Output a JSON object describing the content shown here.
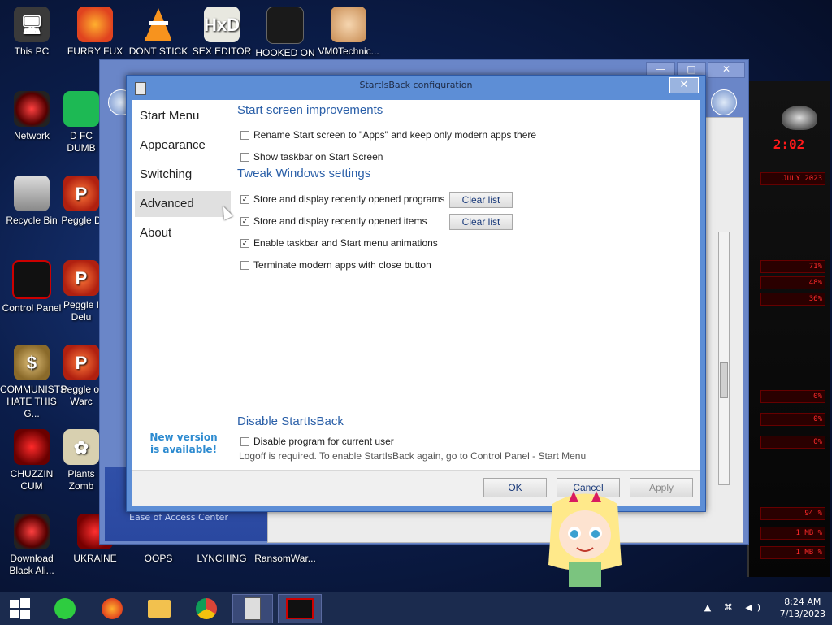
{
  "desktop_icons": [
    {
      "label": "This PC",
      "icon": "computer-icon"
    },
    {
      "label": "FURRY FUX",
      "icon": "firefox-icon"
    },
    {
      "label": "DONT STICK",
      "icon": "vlc-cone-icon"
    },
    {
      "label": "SEX EDITOR",
      "icon": "hxd-icon"
    },
    {
      "label": "HOOKED ON",
      "icon": "hooked-icon"
    },
    {
      "label": "VM0Technic...",
      "icon": "person-icon"
    },
    {
      "label": "Network",
      "icon": "network-icon"
    },
    {
      "label": "D FC DUMB",
      "icon": "spotify-icon"
    },
    {
      "label": "Recycle Bin",
      "icon": "recycle-bin-icon"
    },
    {
      "label": "Peggle D",
      "icon": "peggle-icon"
    },
    {
      "label": "Control Panel",
      "icon": "control-panel-icon"
    },
    {
      "label": "Peggle I Delu",
      "icon": "peggle-icon"
    },
    {
      "label": "COMMUNISTS HATE THIS G...",
      "icon": "money-bag-icon"
    },
    {
      "label": "Peggle of Warc",
      "icon": "peggle-icon"
    },
    {
      "label": "CHUZZIN CUM",
      "icon": "chuzzle-icon"
    },
    {
      "label": "Plants Zomb",
      "icon": "flower-icon"
    },
    {
      "label": "Download Black Ali...",
      "icon": "alien-icon"
    },
    {
      "label": "UKRAINE",
      "icon": "ukraine-icon"
    },
    {
      "label": "OOPS",
      "icon": "oops-icon"
    },
    {
      "label": "LYNCHING",
      "icon": "lynching-icon"
    },
    {
      "label": "RansomWar...",
      "icon": "ransomware-icon"
    }
  ],
  "background_window": {
    "left_link": "Ease of Access Center",
    "buttons": [
      "—",
      "□",
      "✕"
    ]
  },
  "dialog": {
    "title": "StartIsBack configuration",
    "close_glyph": "✕",
    "nav": [
      {
        "label": "Start Menu",
        "selected": false
      },
      {
        "label": "Appearance",
        "selected": false
      },
      {
        "label": "Switching",
        "selected": false
      },
      {
        "label": "Advanced",
        "selected": true
      },
      {
        "label": "About",
        "selected": false
      }
    ],
    "new_version": "New version is available!",
    "sections": {
      "start_screen": {
        "heading": "Start screen improvements",
        "options": [
          {
            "label": "Rename Start screen to \"Apps\" and keep only modern apps there",
            "checked": false
          },
          {
            "label": "Show taskbar on Start Screen",
            "checked": false
          }
        ]
      },
      "tweak": {
        "heading": "Tweak Windows settings",
        "options": [
          {
            "label": "Store and display recently opened programs",
            "checked": true
          },
          {
            "label": "Store and display recently opened items",
            "checked": true
          },
          {
            "label": "Enable taskbar and Start menu animations",
            "checked": true
          },
          {
            "label": "Terminate modern apps with close button",
            "checked": false
          }
        ],
        "clear_list_1": "Clear list",
        "clear_list_2": "Clear list"
      },
      "disable": {
        "heading": "Disable StartIsBack",
        "option": {
          "label": "Disable program for current user",
          "checked": false
        },
        "note": "Logoff is required. To enable StartIsBack again, go to Control Panel - Start Menu"
      }
    },
    "buttons": {
      "ok": "OK",
      "cancel": "Cancel",
      "apply": "Apply"
    }
  },
  "gadget": {
    "clock_fragment": "2:02",
    "date_fragment": "JULY 2023",
    "bars": [
      "71%",
      "48%",
      "36%",
      "0%",
      "0%",
      "0%",
      "94 %",
      "1 MB %",
      "1 MB %"
    ]
  },
  "taskbar": {
    "items": [
      "start-button",
      "notes-app-icon",
      "firefox-icon",
      "file-explorer-icon",
      "chrome-icon",
      "startisback-config-icon",
      "control-panel-icon"
    ],
    "time": "8:24 AM",
    "date": "7/13/2023",
    "tray_glyphs": "▲ ⌘ ◀)"
  }
}
